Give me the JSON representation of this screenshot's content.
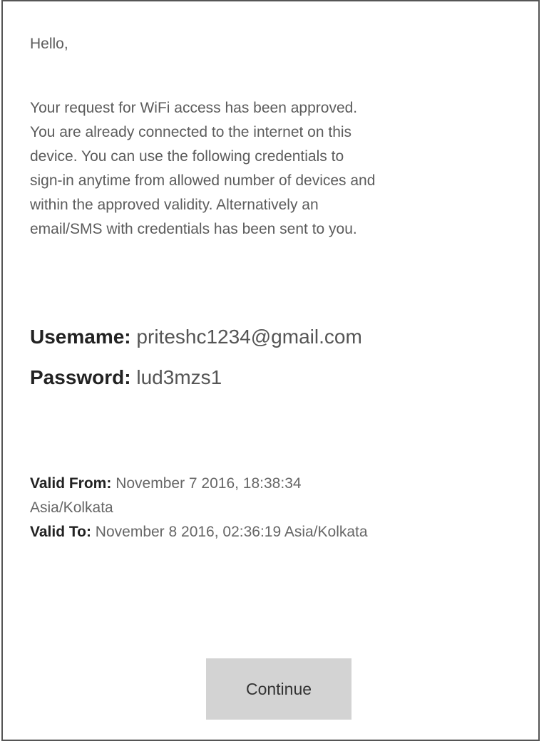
{
  "greeting": "Hello,",
  "message": {
    "lines": [
      "Your request for WiFi access has been approved.",
      "You are already connected to the internet on this",
      "device. You can use the following credentials to",
      "sign-in anytime from allowed number of devices and",
      "within the approved validity. Alternatively an",
      "email/SMS with credentials has been sent to you."
    ]
  },
  "credentials": {
    "username_label": "Usemame:",
    "username_value": "priteshc1234@gmail.com",
    "password_label": "Password:",
    "password_value": "lud3mzs1"
  },
  "validity": {
    "from_label": "Valid From:",
    "from_value_line1": "November 7 2016, 18:38:34",
    "from_value_line2": "Asia/Kolkata",
    "to_label": "Valid To:",
    "to_value": "November 8 2016, 02:36:19 Asia/Kolkata"
  },
  "actions": {
    "continue_label": "Continue"
  }
}
